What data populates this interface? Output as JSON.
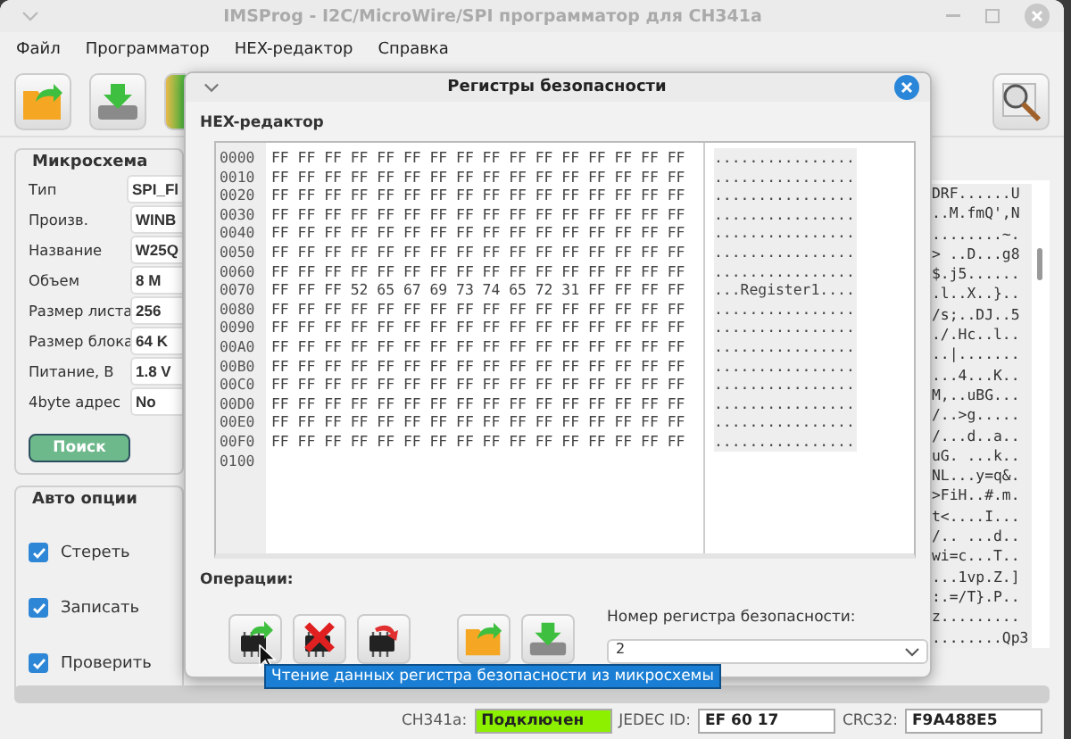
{
  "window": {
    "title": "IMSProg - I2C/MicroWire/SPI программатор для CH341a"
  },
  "menu": [
    "Файл",
    "Программатор",
    "HEX-редактор",
    "Справка"
  ],
  "chip": {
    "title": "Микросхема",
    "fields": [
      {
        "label": "Тип",
        "value": "SPI_Fl"
      },
      {
        "label": "Произв.",
        "value": "WINB"
      },
      {
        "label": "Название",
        "value": "W25Q"
      },
      {
        "label": "Объем",
        "value": "8 M"
      },
      {
        "label": "Размер листа",
        "value": "256"
      },
      {
        "label": "Размер блока",
        "value": "64 K"
      },
      {
        "label": "Питание, В",
        "value": "1.8 V"
      },
      {
        "label": "4byte адрес",
        "value": "No"
      }
    ],
    "search_button": "Поиск"
  },
  "auto_options": {
    "title": "Авто опции",
    "options": [
      {
        "label": "Стереть",
        "checked": true
      },
      {
        "label": "Записать",
        "checked": true
      },
      {
        "label": "Проверить",
        "checked": true
      }
    ]
  },
  "main_ascii": [
    "DRF......U",
    "..M.fmQ',N",
    "........~.",
    "> ..D...g8",
    "$.j5......",
    ".l..X..}..",
    "/s;..DJ..5",
    "./.Hc..l..",
    "..|.......",
    "...4...K..",
    "M,..uBG...",
    "/..>g.....",
    "/...d..a..",
    "uG. ...k..",
    "NL...y=q&.",
    ">FiH..#.m.",
    "t<....I...",
    "/.. ...d..",
    "wi=c...T..",
    "...1vp.Z.]",
    ":.=/T}.P..",
    "z.........",
    "........Qp3"
  ],
  "status_bar": {
    "programmer_label": "CH341a:",
    "connection": "Подключен",
    "connected": true,
    "jedec_label": "JEDEC ID:",
    "jedec": "EF 60 17",
    "crc_label": "CRC32:",
    "crc": "F9A488E5"
  },
  "dialog": {
    "title": "Регистры безопасности",
    "hex_title": "HEX-редактор",
    "hex_rows": [
      {
        "address": "0000",
        "bytes": "FF FF FF FF FF FF FF FF FF FF FF FF FF FF FF FF"
      },
      {
        "address": "0010",
        "bytes": "FF FF FF FF FF FF FF FF FF FF FF FF FF FF FF FF"
      },
      {
        "address": "0020",
        "bytes": "FF FF FF FF FF FF FF FF FF FF FF FF FF FF FF FF"
      },
      {
        "address": "0030",
        "bytes": "FF FF FF FF FF FF FF FF FF FF FF FF FF FF FF FF"
      },
      {
        "address": "0040",
        "bytes": "FF FF FF FF FF FF FF FF FF FF FF FF FF FF FF FF"
      },
      {
        "address": "0050",
        "bytes": "FF FF FF FF FF FF FF FF FF FF FF FF FF FF FF FF"
      },
      {
        "address": "0060",
        "bytes": "FF FF FF FF FF FF FF FF FF FF FF FF FF FF FF FF"
      },
      {
        "address": "0070",
        "bytes": "FF FF FF 52 65 67 69 73 74 65 72 31 FF FF FF FF"
      },
      {
        "address": "0080",
        "bytes": "FF FF FF FF FF FF FF FF FF FF FF FF FF FF FF FF"
      },
      {
        "address": "0090",
        "bytes": "FF FF FF FF FF FF FF FF FF FF FF FF FF FF FF FF"
      },
      {
        "address": "00A0",
        "bytes": "FF FF FF FF FF FF FF FF FF FF FF FF FF FF FF FF"
      },
      {
        "address": "00B0",
        "bytes": "FF FF FF FF FF FF FF FF FF FF FF FF FF FF FF FF"
      },
      {
        "address": "00C0",
        "bytes": "FF FF FF FF FF FF FF FF FF FF FF FF FF FF FF FF"
      },
      {
        "address": "00D0",
        "bytes": "FF FF FF FF FF FF FF FF FF FF FF FF FF FF FF FF"
      },
      {
        "address": "00E0",
        "bytes": "FF FF FF FF FF FF FF FF FF FF FF FF FF FF FF FF"
      },
      {
        "address": "00F0",
        "bytes": "FF FF FF FF FF FF FF FF FF FF FF FF FF FF FF FF"
      },
      {
        "address": "0100",
        "bytes": ""
      }
    ],
    "ascii_rows": [
      "................",
      "................",
      "................",
      "................",
      "................",
      "................",
      "................",
      "...Register1....",
      "................",
      "................",
      "................",
      "................",
      "................",
      "................",
      "................",
      "................"
    ],
    "operations_label": "Операции:",
    "register_label": "Номер регистра безопасности:",
    "register_value": "2",
    "tooltip": "Чтение данных регистра безопасности из микросхемы"
  }
}
